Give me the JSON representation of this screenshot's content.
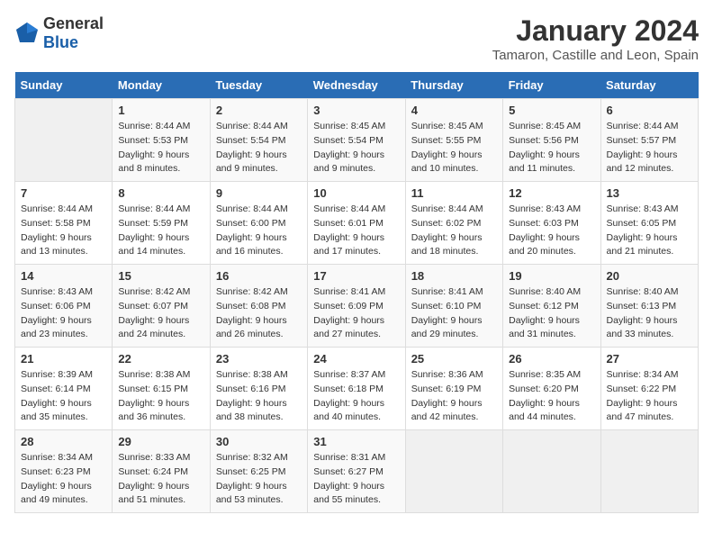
{
  "logo": {
    "general": "General",
    "blue": "Blue"
  },
  "title": "January 2024",
  "subtitle": "Tamaron, Castille and Leon, Spain",
  "days_of_week": [
    "Sunday",
    "Monday",
    "Tuesday",
    "Wednesday",
    "Thursday",
    "Friday",
    "Saturday"
  ],
  "weeks": [
    [
      {
        "day": "",
        "sunrise": "",
        "sunset": "",
        "daylight": ""
      },
      {
        "day": "1",
        "sunrise": "Sunrise: 8:44 AM",
        "sunset": "Sunset: 5:53 PM",
        "daylight": "Daylight: 9 hours and 8 minutes."
      },
      {
        "day": "2",
        "sunrise": "Sunrise: 8:44 AM",
        "sunset": "Sunset: 5:54 PM",
        "daylight": "Daylight: 9 hours and 9 minutes."
      },
      {
        "day": "3",
        "sunrise": "Sunrise: 8:45 AM",
        "sunset": "Sunset: 5:54 PM",
        "daylight": "Daylight: 9 hours and 9 minutes."
      },
      {
        "day": "4",
        "sunrise": "Sunrise: 8:45 AM",
        "sunset": "Sunset: 5:55 PM",
        "daylight": "Daylight: 9 hours and 10 minutes."
      },
      {
        "day": "5",
        "sunrise": "Sunrise: 8:45 AM",
        "sunset": "Sunset: 5:56 PM",
        "daylight": "Daylight: 9 hours and 11 minutes."
      },
      {
        "day": "6",
        "sunrise": "Sunrise: 8:44 AM",
        "sunset": "Sunset: 5:57 PM",
        "daylight": "Daylight: 9 hours and 12 minutes."
      }
    ],
    [
      {
        "day": "7",
        "sunrise": "Sunrise: 8:44 AM",
        "sunset": "Sunset: 5:58 PM",
        "daylight": "Daylight: 9 hours and 13 minutes."
      },
      {
        "day": "8",
        "sunrise": "Sunrise: 8:44 AM",
        "sunset": "Sunset: 5:59 PM",
        "daylight": "Daylight: 9 hours and 14 minutes."
      },
      {
        "day": "9",
        "sunrise": "Sunrise: 8:44 AM",
        "sunset": "Sunset: 6:00 PM",
        "daylight": "Daylight: 9 hours and 16 minutes."
      },
      {
        "day": "10",
        "sunrise": "Sunrise: 8:44 AM",
        "sunset": "Sunset: 6:01 PM",
        "daylight": "Daylight: 9 hours and 17 minutes."
      },
      {
        "day": "11",
        "sunrise": "Sunrise: 8:44 AM",
        "sunset": "Sunset: 6:02 PM",
        "daylight": "Daylight: 9 hours and 18 minutes."
      },
      {
        "day": "12",
        "sunrise": "Sunrise: 8:43 AM",
        "sunset": "Sunset: 6:03 PM",
        "daylight": "Daylight: 9 hours and 20 minutes."
      },
      {
        "day": "13",
        "sunrise": "Sunrise: 8:43 AM",
        "sunset": "Sunset: 6:05 PM",
        "daylight": "Daylight: 9 hours and 21 minutes."
      }
    ],
    [
      {
        "day": "14",
        "sunrise": "Sunrise: 8:43 AM",
        "sunset": "Sunset: 6:06 PM",
        "daylight": "Daylight: 9 hours and 23 minutes."
      },
      {
        "day": "15",
        "sunrise": "Sunrise: 8:42 AM",
        "sunset": "Sunset: 6:07 PM",
        "daylight": "Daylight: 9 hours and 24 minutes."
      },
      {
        "day": "16",
        "sunrise": "Sunrise: 8:42 AM",
        "sunset": "Sunset: 6:08 PM",
        "daylight": "Daylight: 9 hours and 26 minutes."
      },
      {
        "day": "17",
        "sunrise": "Sunrise: 8:41 AM",
        "sunset": "Sunset: 6:09 PM",
        "daylight": "Daylight: 9 hours and 27 minutes."
      },
      {
        "day": "18",
        "sunrise": "Sunrise: 8:41 AM",
        "sunset": "Sunset: 6:10 PM",
        "daylight": "Daylight: 9 hours and 29 minutes."
      },
      {
        "day": "19",
        "sunrise": "Sunrise: 8:40 AM",
        "sunset": "Sunset: 6:12 PM",
        "daylight": "Daylight: 9 hours and 31 minutes."
      },
      {
        "day": "20",
        "sunrise": "Sunrise: 8:40 AM",
        "sunset": "Sunset: 6:13 PM",
        "daylight": "Daylight: 9 hours and 33 minutes."
      }
    ],
    [
      {
        "day": "21",
        "sunrise": "Sunrise: 8:39 AM",
        "sunset": "Sunset: 6:14 PM",
        "daylight": "Daylight: 9 hours and 35 minutes."
      },
      {
        "day": "22",
        "sunrise": "Sunrise: 8:38 AM",
        "sunset": "Sunset: 6:15 PM",
        "daylight": "Daylight: 9 hours and 36 minutes."
      },
      {
        "day": "23",
        "sunrise": "Sunrise: 8:38 AM",
        "sunset": "Sunset: 6:16 PM",
        "daylight": "Daylight: 9 hours and 38 minutes."
      },
      {
        "day": "24",
        "sunrise": "Sunrise: 8:37 AM",
        "sunset": "Sunset: 6:18 PM",
        "daylight": "Daylight: 9 hours and 40 minutes."
      },
      {
        "day": "25",
        "sunrise": "Sunrise: 8:36 AM",
        "sunset": "Sunset: 6:19 PM",
        "daylight": "Daylight: 9 hours and 42 minutes."
      },
      {
        "day": "26",
        "sunrise": "Sunrise: 8:35 AM",
        "sunset": "Sunset: 6:20 PM",
        "daylight": "Daylight: 9 hours and 44 minutes."
      },
      {
        "day": "27",
        "sunrise": "Sunrise: 8:34 AM",
        "sunset": "Sunset: 6:22 PM",
        "daylight": "Daylight: 9 hours and 47 minutes."
      }
    ],
    [
      {
        "day": "28",
        "sunrise": "Sunrise: 8:34 AM",
        "sunset": "Sunset: 6:23 PM",
        "daylight": "Daylight: 9 hours and 49 minutes."
      },
      {
        "day": "29",
        "sunrise": "Sunrise: 8:33 AM",
        "sunset": "Sunset: 6:24 PM",
        "daylight": "Daylight: 9 hours and 51 minutes."
      },
      {
        "day": "30",
        "sunrise": "Sunrise: 8:32 AM",
        "sunset": "Sunset: 6:25 PM",
        "daylight": "Daylight: 9 hours and 53 minutes."
      },
      {
        "day": "31",
        "sunrise": "Sunrise: 8:31 AM",
        "sunset": "Sunset: 6:27 PM",
        "daylight": "Daylight: 9 hours and 55 minutes."
      },
      {
        "day": "",
        "sunrise": "",
        "sunset": "",
        "daylight": ""
      },
      {
        "day": "",
        "sunrise": "",
        "sunset": "",
        "daylight": ""
      },
      {
        "day": "",
        "sunrise": "",
        "sunset": "",
        "daylight": ""
      }
    ]
  ]
}
